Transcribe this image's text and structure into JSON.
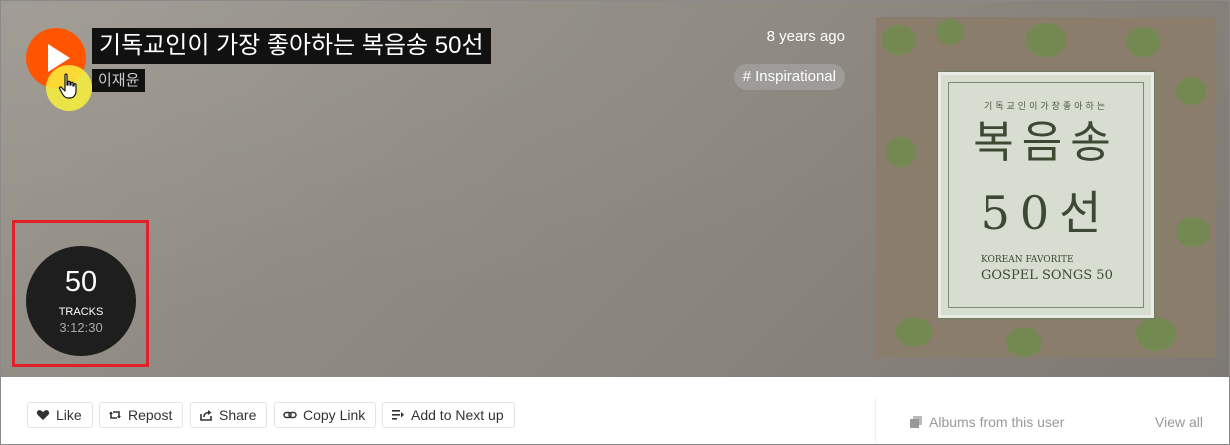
{
  "header": {
    "title": "기독교인이 가장 좋아하는 복음송 50선",
    "artist": "이재윤",
    "posted": "8 years ago",
    "tag": "# Inspirational"
  },
  "tracks": {
    "count": "50",
    "label": "TRACKS",
    "duration": "3:12:30"
  },
  "artwork": {
    "small_text": "기독교인이가장좋아하는",
    "big_text_1": "복음송",
    "big_text_2": "50선",
    "eng_line_1": "KOREAN FAVORITE",
    "eng_line_2": "GOSPEL SONGS 50"
  },
  "actions": {
    "like": "Like",
    "repost": "Repost",
    "share": "Share",
    "copy_link": "Copy Link",
    "add_next": "Add to Next up"
  },
  "sidebar": {
    "albums_heading": "Albums from this user",
    "view_all": "View all"
  },
  "colors": {
    "accent": "#ff5500",
    "highlight_outline": "#e0202a",
    "cursor_highlight": "#faf03c"
  }
}
